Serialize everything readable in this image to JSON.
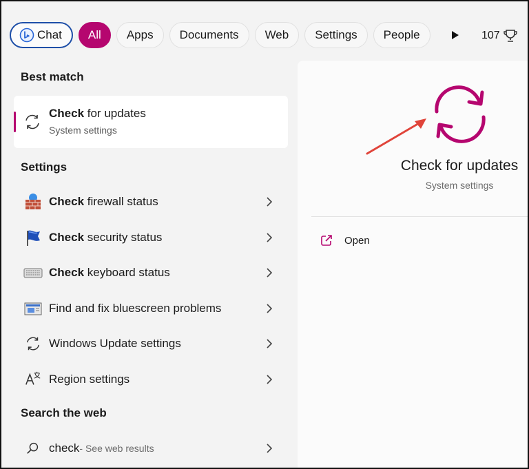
{
  "filters": {
    "chat": "Chat",
    "all": "All",
    "apps": "Apps",
    "documents": "Documents",
    "web": "Web",
    "settings": "Settings",
    "people": "People",
    "points": "107"
  },
  "sections": {
    "best_match": "Best match",
    "settings": "Settings",
    "search_web": "Search the web"
  },
  "best_match": {
    "title_bold": "Check",
    "title_rest": " for updates",
    "subtitle": "System settings"
  },
  "settings_items": [
    {
      "bold": "Check",
      "rest": " firewall status",
      "icon": "firewall-icon"
    },
    {
      "bold": "Check",
      "rest": " security status",
      "icon": "security-flag-icon"
    },
    {
      "bold": "Check",
      "rest": " keyboard status",
      "icon": "keyboard-icon"
    },
    {
      "bold": "",
      "rest": "Find and fix bluescreen problems",
      "icon": "troubleshoot-icon"
    },
    {
      "bold": "",
      "rest": "Windows Update settings",
      "icon": "sync-icon"
    },
    {
      "bold": "",
      "rest": "Region settings",
      "icon": "region-icon"
    }
  ],
  "web": {
    "query": "check",
    "suffix": " - See web results"
  },
  "detail": {
    "title": "Check for updates",
    "subtitle": "System settings",
    "open_label": "Open"
  },
  "colors": {
    "accent": "#b5066f",
    "chat_border": "#1e4fa8",
    "annotation_arrow": "#e0443a"
  }
}
